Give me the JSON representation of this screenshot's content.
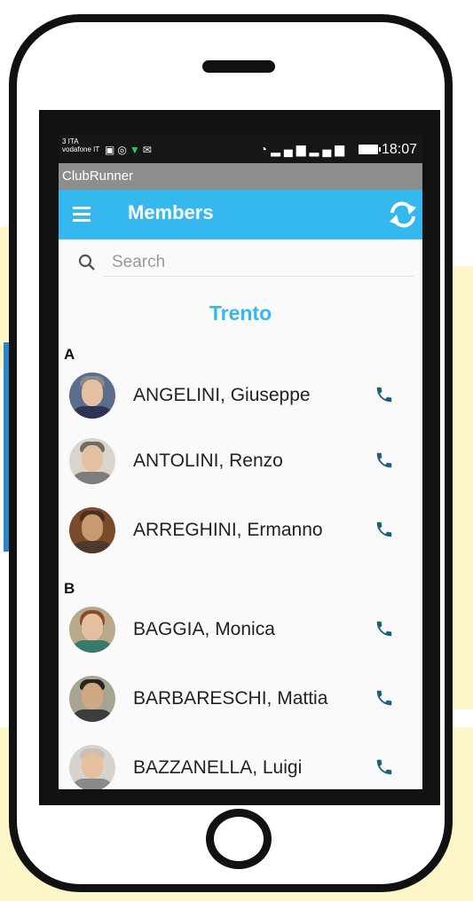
{
  "status_bar": {
    "carrier_line1": "3 ITA",
    "carrier_line2": "vodafone IT",
    "time": "18:07"
  },
  "app_name": "ClubRunner",
  "toolbar": {
    "title": "Members"
  },
  "search": {
    "placeholder": "Search",
    "value": ""
  },
  "club_name": "Trento",
  "sections": [
    {
      "letter": "A",
      "members": [
        {
          "name": "ANGELINI, Giuseppe"
        },
        {
          "name": "ANTOLINI, Renzo"
        },
        {
          "name": "ARREGHINI, Ermanno"
        }
      ]
    },
    {
      "letter": "B",
      "members": [
        {
          "name": "BAGGIA, Monica"
        },
        {
          "name": "BARBARESCHI, Mattia"
        },
        {
          "name": "BAZZANELLA, Luigi"
        }
      ]
    }
  ],
  "colors": {
    "accent": "#35b8ee",
    "phone_icon": "#1e5f7a",
    "app_bar": "#8e8e8e"
  },
  "icons": [
    "menu-icon",
    "refresh-icon",
    "search-icon",
    "phone-icon"
  ]
}
